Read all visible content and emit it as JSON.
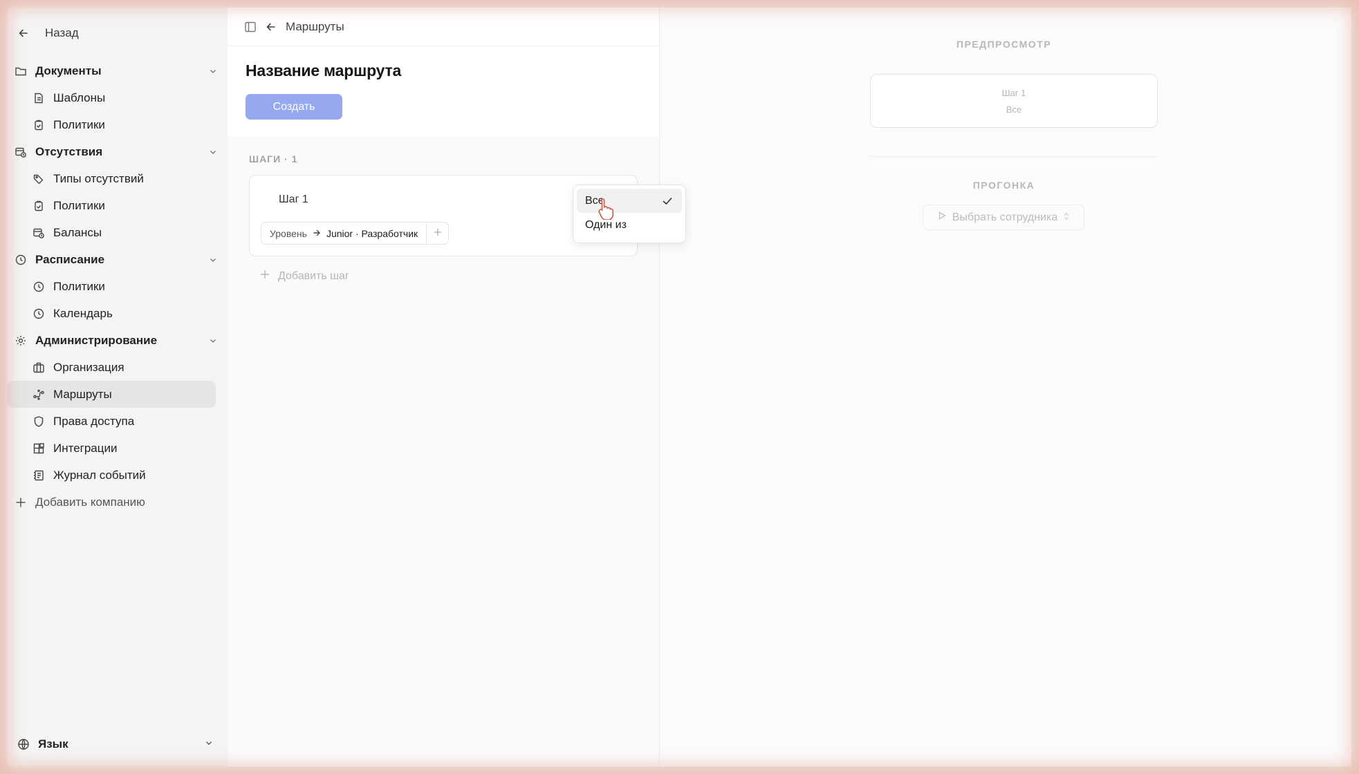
{
  "sidebar": {
    "back_label": "Назад",
    "groups": [
      {
        "label": "Документы",
        "icon": "folder-icon",
        "items": [
          {
            "label": "Шаблоны",
            "icon": "file-icon"
          },
          {
            "label": "Политики",
            "icon": "clipboard-icon"
          }
        ]
      },
      {
        "label": "Отсутствия",
        "icon": "calendar-clock-icon",
        "items": [
          {
            "label": "Типы отсутствий",
            "icon": "tag-icon"
          },
          {
            "label": "Политики",
            "icon": "clipboard-icon"
          },
          {
            "label": "Балансы",
            "icon": "calendar-clock-icon"
          }
        ]
      },
      {
        "label": "Расписание",
        "icon": "clock-icon",
        "items": [
          {
            "label": "Политики",
            "icon": "clock-icon"
          },
          {
            "label": "Календарь",
            "icon": "clock-icon"
          }
        ]
      },
      {
        "label": "Администрирование",
        "icon": "gear-icon",
        "items": [
          {
            "label": "Организация",
            "icon": "building-icon"
          },
          {
            "label": "Маршруты",
            "icon": "route-icon",
            "active": true
          },
          {
            "label": "Права доступа",
            "icon": "shield-icon"
          },
          {
            "label": "Интеграции",
            "icon": "blocks-icon"
          },
          {
            "label": "Журнал событий",
            "icon": "log-icon"
          }
        ]
      }
    ],
    "add_company": "Добавить компанию",
    "language": "Язык"
  },
  "editor": {
    "breadcrumb": "Маршруты",
    "title": "Название маршрута",
    "create_button": "Создать",
    "steps_label": "ШАГИ · 1",
    "step": {
      "name": "Шаг 1",
      "condition_key": "Уровень",
      "condition_value": "Junior · Разработчик"
    },
    "add_step": "Добавить шаг"
  },
  "dropdown": {
    "options": [
      "Все",
      "Один из"
    ],
    "selected": "Все"
  },
  "preview": {
    "label": "ПРЕДПРОСМОТР",
    "card_title": "Шаг 1",
    "card_mode": "Все",
    "run_label": "ПРОГОНКА",
    "pick_employee": "Выбрать сотрудника"
  },
  "colors": {
    "accent": "#96a8f0",
    "active_bg": "#e5e5e6"
  }
}
